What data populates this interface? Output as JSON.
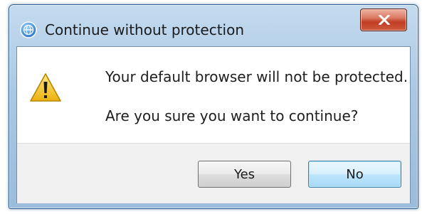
{
  "dialog": {
    "title": "Continue without protection",
    "close_label": "x"
  },
  "message": {
    "primary": "Your default browser will not be protected.",
    "secondary": "Are you sure you want to continue?"
  },
  "buttons": {
    "yes_label": "Yes",
    "no_label": "No"
  },
  "icons": {
    "app": "globe-icon",
    "close": "close-icon",
    "message": "warning-icon"
  },
  "colors": {
    "titlebar": "#b7d1ea",
    "close_button": "#c74a2e",
    "warning_fill": "#f2c21b",
    "default_button_border": "#3c7fb1"
  }
}
